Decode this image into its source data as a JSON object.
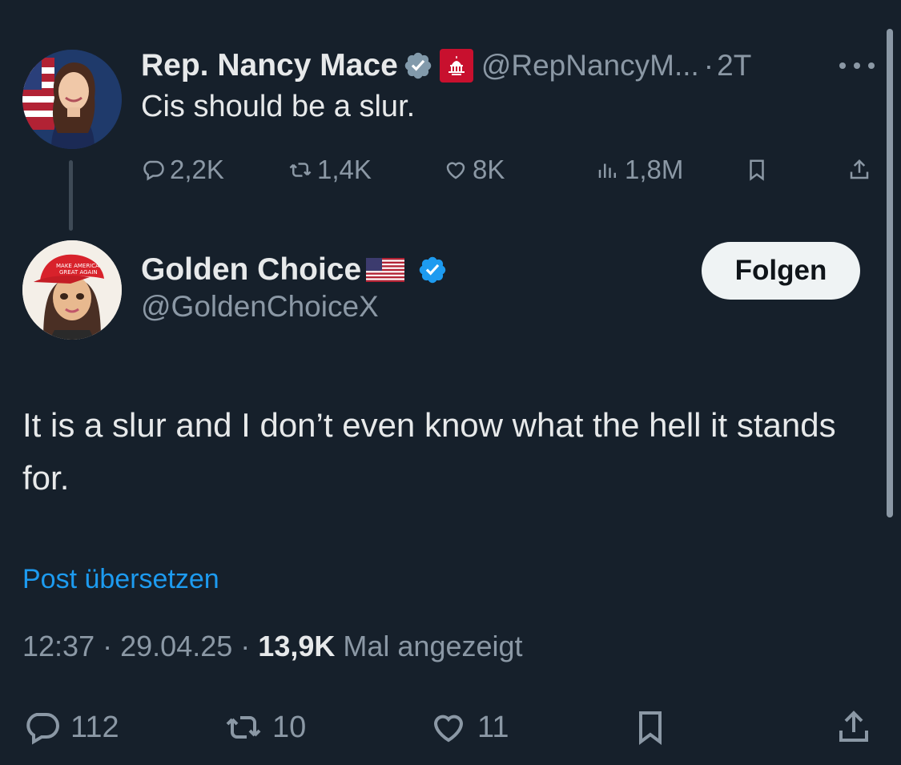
{
  "parent_tweet": {
    "author_name": "Rep. Nancy Mace",
    "handle": "@RepNancyM...",
    "separator": "·",
    "time_ago": "2T",
    "text": "Cis should be a slur.",
    "badges": [
      "verified-gray-icon",
      "house-gop-icon"
    ],
    "stats": {
      "replies": "2,2K",
      "reposts": "1,4K",
      "likes": "8K",
      "views": "1,8M"
    }
  },
  "reply_tweet": {
    "author_name": "Golden Choice",
    "handle": "@GoldenChoiceX",
    "follow_label": "Folgen",
    "text": "It is a slur and I don’t even know what the hell it stands for.",
    "translate_label": "Post übersetzen",
    "meta": {
      "time": "12:37",
      "date": "29.04.25",
      "sep": "·",
      "views_count": "13,9K",
      "views_label": "Mal angezeigt"
    },
    "stats": {
      "replies": "112",
      "reposts": "10",
      "likes": "11"
    }
  },
  "colors": {
    "background": "#16202b",
    "text_primary": "#e7e9ea",
    "text_secondary": "#8b98a5",
    "link": "#1d9bf0",
    "verified_blue": "#1d9bf0"
  }
}
